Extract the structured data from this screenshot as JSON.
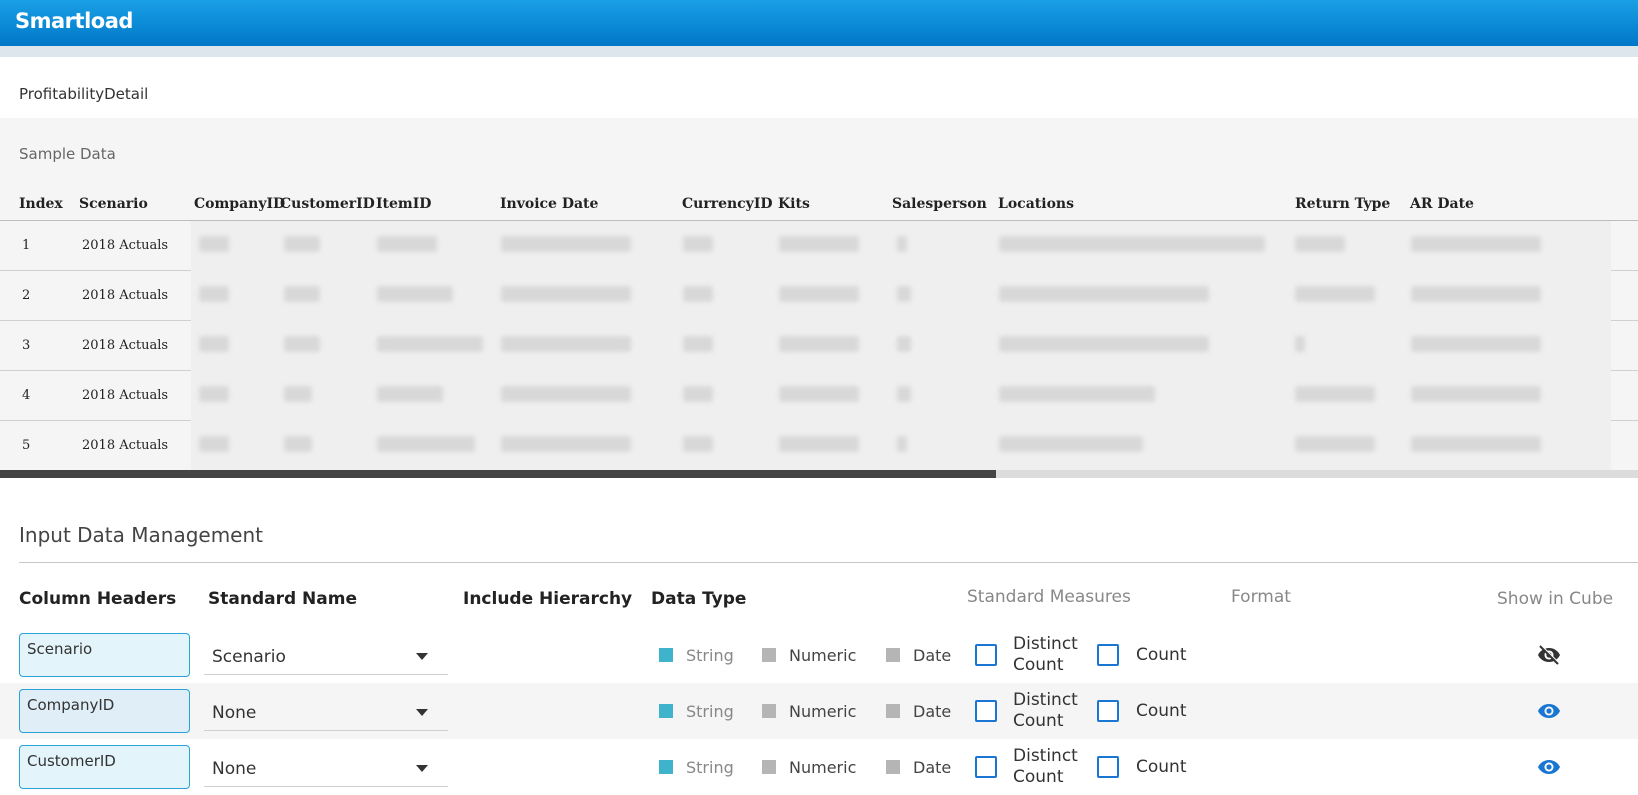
{
  "app": {
    "title": "Smartload"
  },
  "table_name": "ProfitabilityDetail",
  "sample_data": {
    "title": "Sample Data",
    "columns": [
      "Index",
      "Scenario",
      "CompanyID",
      "CustomerID",
      "ItemID",
      "Invoice Date",
      "CurrencyID",
      "Kits",
      "Salesperson",
      "Locations",
      "Return Type",
      "AR Date"
    ],
    "rows": [
      {
        "index": "1",
        "scenario": "2018 Actuals"
      },
      {
        "index": "2",
        "scenario": "2018 Actuals"
      },
      {
        "index": "3",
        "scenario": "2018 Actuals"
      },
      {
        "index": "4",
        "scenario": "2018 Actuals"
      },
      {
        "index": "5",
        "scenario": "2018 Actuals"
      }
    ]
  },
  "input_data_management": {
    "title": "Input Data Management",
    "headers": {
      "column_headers": "Column Headers",
      "standard_name": "Standard Name",
      "include_hierarchy": "Include Hierarchy",
      "data_type": "Data Type",
      "standard_measures": "Standard Measures",
      "format": "Format",
      "show_in_cube": "Show in Cube"
    },
    "data_type_options": {
      "string": "String",
      "numeric": "Numeric",
      "date": "Date"
    },
    "measure_options": {
      "distinct_count_line1": "Distinct",
      "distinct_count_line2": "Count",
      "count": "Count"
    },
    "rows": [
      {
        "column": "Scenario",
        "standard_name": "Scenario",
        "data_type": "String",
        "show_in_cube": "hidden",
        "eye_icon": "eye-off-icon"
      },
      {
        "column": "CompanyID",
        "standard_name": "None",
        "data_type": "String",
        "show_in_cube": "visible",
        "eye_icon": "eye-icon"
      },
      {
        "column": "CustomerID",
        "standard_name": "None",
        "data_type": "String",
        "show_in_cube": "visible",
        "eye_icon": "eye-icon"
      }
    ],
    "colors": {
      "accent": "#1976d2",
      "selected_type": "#3fb3cc",
      "header_gradient_top": "#1aa0e6",
      "header_gradient_bottom": "#0077c8"
    }
  }
}
